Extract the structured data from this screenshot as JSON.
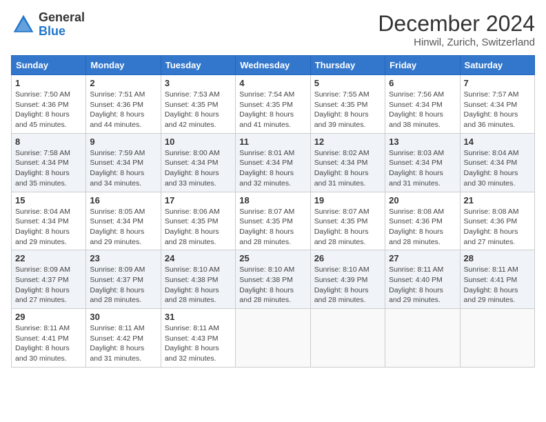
{
  "header": {
    "logo_general": "General",
    "logo_blue": "Blue",
    "month_title": "December 2024",
    "location": "Hinwil, Zurich, Switzerland"
  },
  "days_of_week": [
    "Sunday",
    "Monday",
    "Tuesday",
    "Wednesday",
    "Thursday",
    "Friday",
    "Saturday"
  ],
  "weeks": [
    [
      {
        "day": "1",
        "sunrise": "Sunrise: 7:50 AM",
        "sunset": "Sunset: 4:36 PM",
        "daylight": "Daylight: 8 hours and 45 minutes."
      },
      {
        "day": "2",
        "sunrise": "Sunrise: 7:51 AM",
        "sunset": "Sunset: 4:36 PM",
        "daylight": "Daylight: 8 hours and 44 minutes."
      },
      {
        "day": "3",
        "sunrise": "Sunrise: 7:53 AM",
        "sunset": "Sunset: 4:35 PM",
        "daylight": "Daylight: 8 hours and 42 minutes."
      },
      {
        "day": "4",
        "sunrise": "Sunrise: 7:54 AM",
        "sunset": "Sunset: 4:35 PM",
        "daylight": "Daylight: 8 hours and 41 minutes."
      },
      {
        "day": "5",
        "sunrise": "Sunrise: 7:55 AM",
        "sunset": "Sunset: 4:35 PM",
        "daylight": "Daylight: 8 hours and 39 minutes."
      },
      {
        "day": "6",
        "sunrise": "Sunrise: 7:56 AM",
        "sunset": "Sunset: 4:34 PM",
        "daylight": "Daylight: 8 hours and 38 minutes."
      },
      {
        "day": "7",
        "sunrise": "Sunrise: 7:57 AM",
        "sunset": "Sunset: 4:34 PM",
        "daylight": "Daylight: 8 hours and 36 minutes."
      }
    ],
    [
      {
        "day": "8",
        "sunrise": "Sunrise: 7:58 AM",
        "sunset": "Sunset: 4:34 PM",
        "daylight": "Daylight: 8 hours and 35 minutes."
      },
      {
        "day": "9",
        "sunrise": "Sunrise: 7:59 AM",
        "sunset": "Sunset: 4:34 PM",
        "daylight": "Daylight: 8 hours and 34 minutes."
      },
      {
        "day": "10",
        "sunrise": "Sunrise: 8:00 AM",
        "sunset": "Sunset: 4:34 PM",
        "daylight": "Daylight: 8 hours and 33 minutes."
      },
      {
        "day": "11",
        "sunrise": "Sunrise: 8:01 AM",
        "sunset": "Sunset: 4:34 PM",
        "daylight": "Daylight: 8 hours and 32 minutes."
      },
      {
        "day": "12",
        "sunrise": "Sunrise: 8:02 AM",
        "sunset": "Sunset: 4:34 PM",
        "daylight": "Daylight: 8 hours and 31 minutes."
      },
      {
        "day": "13",
        "sunrise": "Sunrise: 8:03 AM",
        "sunset": "Sunset: 4:34 PM",
        "daylight": "Daylight: 8 hours and 31 minutes."
      },
      {
        "day": "14",
        "sunrise": "Sunrise: 8:04 AM",
        "sunset": "Sunset: 4:34 PM",
        "daylight": "Daylight: 8 hours and 30 minutes."
      }
    ],
    [
      {
        "day": "15",
        "sunrise": "Sunrise: 8:04 AM",
        "sunset": "Sunset: 4:34 PM",
        "daylight": "Daylight: 8 hours and 29 minutes."
      },
      {
        "day": "16",
        "sunrise": "Sunrise: 8:05 AM",
        "sunset": "Sunset: 4:34 PM",
        "daylight": "Daylight: 8 hours and 29 minutes."
      },
      {
        "day": "17",
        "sunrise": "Sunrise: 8:06 AM",
        "sunset": "Sunset: 4:35 PM",
        "daylight": "Daylight: 8 hours and 28 minutes."
      },
      {
        "day": "18",
        "sunrise": "Sunrise: 8:07 AM",
        "sunset": "Sunset: 4:35 PM",
        "daylight": "Daylight: 8 hours and 28 minutes."
      },
      {
        "day": "19",
        "sunrise": "Sunrise: 8:07 AM",
        "sunset": "Sunset: 4:35 PM",
        "daylight": "Daylight: 8 hours and 28 minutes."
      },
      {
        "day": "20",
        "sunrise": "Sunrise: 8:08 AM",
        "sunset": "Sunset: 4:36 PM",
        "daylight": "Daylight: 8 hours and 28 minutes."
      },
      {
        "day": "21",
        "sunrise": "Sunrise: 8:08 AM",
        "sunset": "Sunset: 4:36 PM",
        "daylight": "Daylight: 8 hours and 27 minutes."
      }
    ],
    [
      {
        "day": "22",
        "sunrise": "Sunrise: 8:09 AM",
        "sunset": "Sunset: 4:37 PM",
        "daylight": "Daylight: 8 hours and 27 minutes."
      },
      {
        "day": "23",
        "sunrise": "Sunrise: 8:09 AM",
        "sunset": "Sunset: 4:37 PM",
        "daylight": "Daylight: 8 hours and 28 minutes."
      },
      {
        "day": "24",
        "sunrise": "Sunrise: 8:10 AM",
        "sunset": "Sunset: 4:38 PM",
        "daylight": "Daylight: 8 hours and 28 minutes."
      },
      {
        "day": "25",
        "sunrise": "Sunrise: 8:10 AM",
        "sunset": "Sunset: 4:38 PM",
        "daylight": "Daylight: 8 hours and 28 minutes."
      },
      {
        "day": "26",
        "sunrise": "Sunrise: 8:10 AM",
        "sunset": "Sunset: 4:39 PM",
        "daylight": "Daylight: 8 hours and 28 minutes."
      },
      {
        "day": "27",
        "sunrise": "Sunrise: 8:11 AM",
        "sunset": "Sunset: 4:40 PM",
        "daylight": "Daylight: 8 hours and 29 minutes."
      },
      {
        "day": "28",
        "sunrise": "Sunrise: 8:11 AM",
        "sunset": "Sunset: 4:41 PM",
        "daylight": "Daylight: 8 hours and 29 minutes."
      }
    ],
    [
      {
        "day": "29",
        "sunrise": "Sunrise: 8:11 AM",
        "sunset": "Sunset: 4:41 PM",
        "daylight": "Daylight: 8 hours and 30 minutes."
      },
      {
        "day": "30",
        "sunrise": "Sunrise: 8:11 AM",
        "sunset": "Sunset: 4:42 PM",
        "daylight": "Daylight: 8 hours and 31 minutes."
      },
      {
        "day": "31",
        "sunrise": "Sunrise: 8:11 AM",
        "sunset": "Sunset: 4:43 PM",
        "daylight": "Daylight: 8 hours and 32 minutes."
      },
      null,
      null,
      null,
      null
    ]
  ]
}
